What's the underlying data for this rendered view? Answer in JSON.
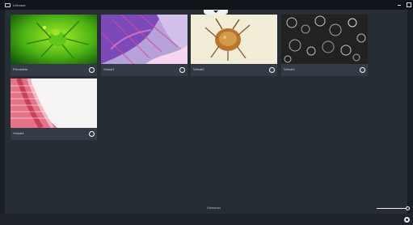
{
  "window": {
    "title": "Lifecase",
    "app_icon": "window-icon",
    "minimize_icon": "minimize-icon",
    "maximize_icon": "maximize-icon"
  },
  "collapse_icon": "chevron-down-icon",
  "gallery": {
    "items": [
      {
        "label": "Prevadest",
        "selected_icon": "radio-ring-icon"
      },
      {
        "label": "Virtual1",
        "selected_icon": "radio-ring-icon"
      },
      {
        "label": "Virtual2",
        "selected_icon": "radio-ring-icon"
      },
      {
        "label": "Virtual3",
        "selected_icon": "radio-ring-icon"
      },
      {
        "label": "Virtual4",
        "selected_icon": "radio-ring-icon"
      }
    ]
  },
  "status": {
    "text": "Ultrascan",
    "zoom_level": 1
  },
  "settings_icon": "gear-icon"
}
